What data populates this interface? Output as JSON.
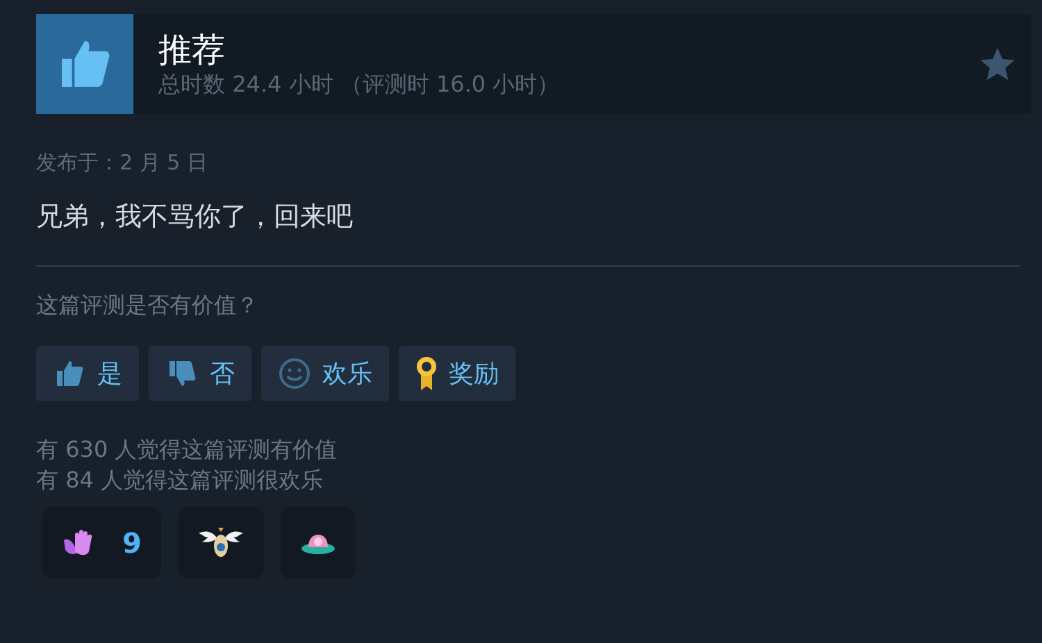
{
  "header": {
    "verdict": "推荐",
    "recommended": true,
    "playtime": "总时数 24.4 小时 （评测时 16.0 小时）"
  },
  "posted": "发布于：2 月 5 日",
  "review": "兄弟，我不骂你了，回来吧",
  "question": "这篇评测是否有价值？",
  "buttons": [
    {
      "kind": "yes",
      "label": "是"
    },
    {
      "kind": "no",
      "label": "否"
    },
    {
      "kind": "funny",
      "label": "欢乐"
    },
    {
      "kind": "award",
      "label": "奖励"
    }
  ],
  "stats": [
    "有 630 人觉得这篇评测有价值",
    "有 84 人觉得这篇评测很欢乐"
  ],
  "awards": [
    {
      "kind": "clap",
      "count": "9"
    },
    {
      "kind": "winged"
    },
    {
      "kind": "ufo"
    }
  ]
}
